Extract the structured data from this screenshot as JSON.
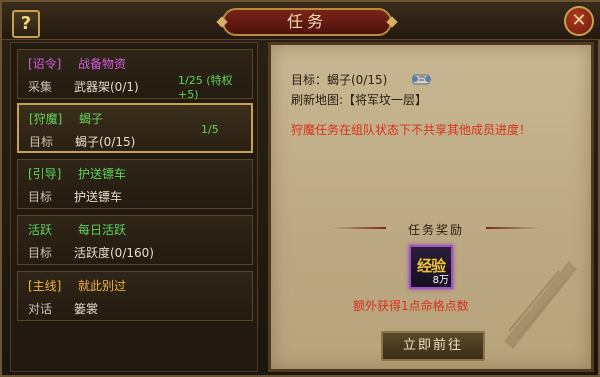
{
  "window": {
    "title": "任务",
    "help_label": "?",
    "close_label": "✕"
  },
  "quests": [
    {
      "tag": "[诏令]",
      "name": "战备物资",
      "verb": "采集",
      "target": "武器架(0/1)",
      "progress": "1/25 (特权+5)",
      "color": "#d45be0",
      "progress_color": "#5fd35a"
    },
    {
      "tag": "[狩魔]",
      "name": "蝎子",
      "verb": "目标",
      "target": "蝎子(0/15)",
      "progress": "1/5",
      "color": "#5fd35a",
      "progress_color": "#5fd35a",
      "selected": true
    },
    {
      "tag": "[引导]",
      "name": "护送镖车",
      "verb": "目标",
      "target": "护送镖车",
      "progress": "",
      "color": "#5fd35a"
    },
    {
      "tag": "活跃",
      "name": "每日活跃",
      "verb": "目标",
      "target": "活跃度(0/160)",
      "progress": "",
      "color": "#5fd35a"
    },
    {
      "tag": "[主线]",
      "name": "就此别过",
      "verb": "对话",
      "target": "篓裳",
      "progress": "",
      "color": "#f0b440"
    }
  ],
  "detail": {
    "target_line": "目标：蝎子(0/15)",
    "map_line": "刷新地图:【将军坟一层】",
    "warning": "狩魔任务在组队状态下不共享其他成员进度！",
    "reward_heading": "任务奖励",
    "reward": {
      "label": "经验",
      "amount": "8万",
      "border_color": "#a04fd0"
    },
    "bonus": "额外获得1点命格点数",
    "go_button": "立即前往",
    "icons": [
      "scroll-icon"
    ]
  }
}
